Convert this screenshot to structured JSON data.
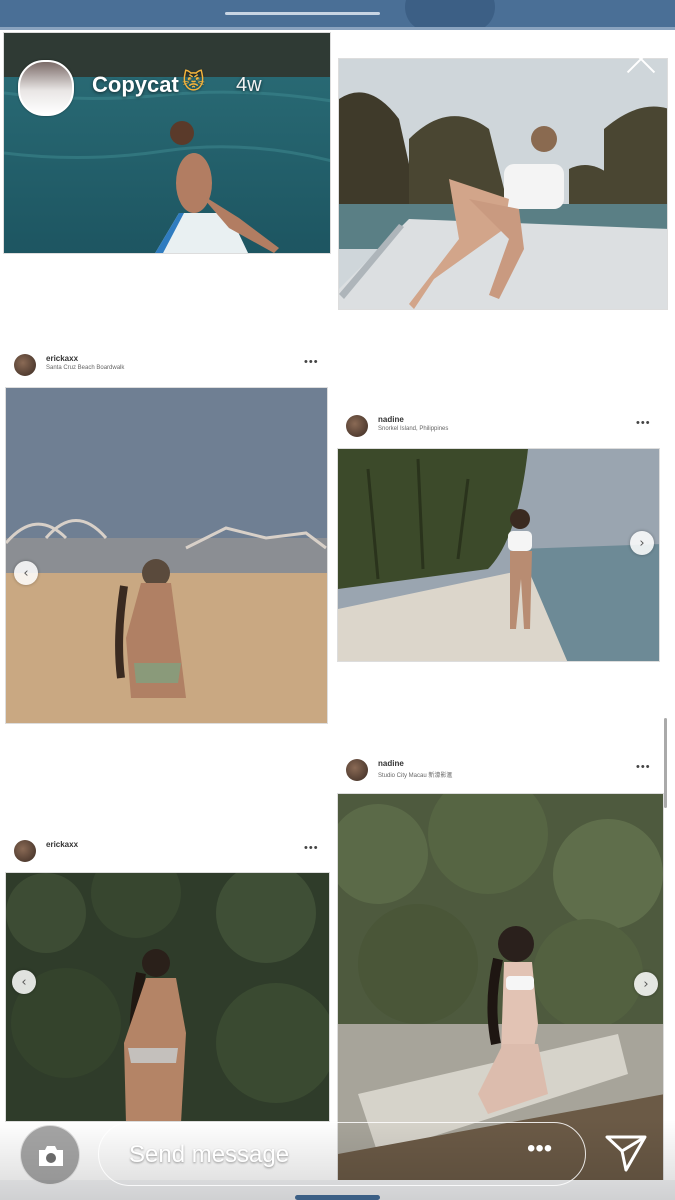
{
  "story": {
    "username": "Copycat",
    "emoji": "😾",
    "time": "4w"
  },
  "posts": [
    {
      "username": "erickaxx",
      "location": "Santa Cruz Beach Boardwalk"
    },
    {
      "username": "nadine",
      "location": "Snorkel Island, Philippines"
    },
    {
      "username": "nadine",
      "location": "Studio City Macau 新濠影滙"
    },
    {
      "username": "erickaxx",
      "location": ""
    }
  ],
  "more_label": "•••",
  "carousel_arrows": {
    "left": "‹",
    "right": "›"
  },
  "reply": {
    "placeholder": "Send message",
    "more": "•••"
  },
  "icons": {
    "camera": "camera-icon",
    "send": "send-icon",
    "close": "close-icon"
  },
  "colors": {
    "top_bar": "#4a6f96",
    "background": "#ffffff"
  }
}
